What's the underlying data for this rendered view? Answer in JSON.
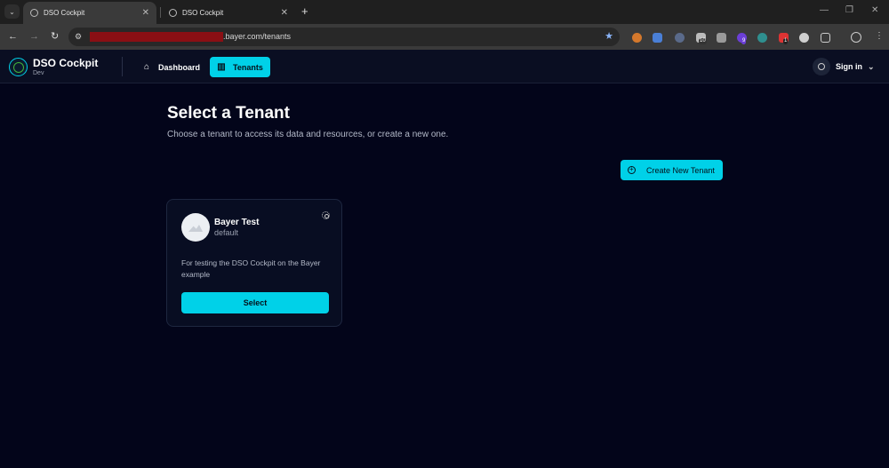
{
  "browser": {
    "tabs": [
      {
        "title": "DSO Cockpit",
        "active": true
      },
      {
        "title": "DSO Cockpit",
        "active": false
      }
    ],
    "new_tab_label": "+",
    "url_visible": ".bayer.com/tenants",
    "extension_badges": [
      "10",
      "9",
      "1"
    ]
  },
  "header": {
    "brand_title": "DSO Cockpit",
    "brand_env": "Dev",
    "nav": [
      {
        "label": "Dashboard",
        "icon": "home-icon",
        "active": false
      },
      {
        "label": "Tenants",
        "icon": "building-icon",
        "active": true
      }
    ],
    "signin_label": "Sign in"
  },
  "main": {
    "title": "Select a Tenant",
    "subtitle": "Choose a tenant to access its data and resources, or create a new one.",
    "create_button_label": "Create New Tenant",
    "tenants": [
      {
        "name": "Bayer Test",
        "slug": "default",
        "description": "For testing the DSO Cockpit on the Bayer example",
        "select_label": "Select"
      }
    ]
  },
  "colors": {
    "accent": "#00d1e8",
    "background": "#03051a",
    "card": "#080d22",
    "header": "#0a0e22"
  }
}
